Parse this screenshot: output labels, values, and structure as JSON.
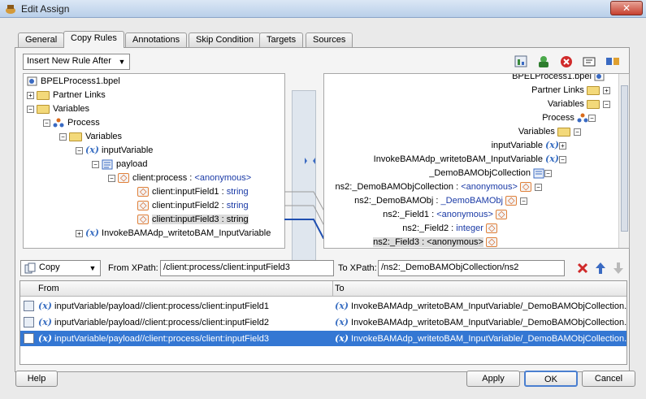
{
  "window": {
    "title": "Edit Assign",
    "close_glyph": "✕"
  },
  "tabs": [
    {
      "label": "General"
    },
    {
      "label": "Copy Rules",
      "active": true
    },
    {
      "label": "Annotations"
    },
    {
      "label": "Skip Condition"
    },
    {
      "label": "Targets"
    },
    {
      "label": "Sources"
    }
  ],
  "rule_combo": {
    "value": "Insert New Rule After"
  },
  "toolbar_icons": [
    "expression-icon",
    "add-icon",
    "delete-icon",
    "xml-literal-icon",
    "transform-icon"
  ],
  "source_tree": [
    {
      "label": "BPELProcess1.bpel"
    },
    {
      "label": "Partner Links"
    },
    {
      "label": "Variables"
    },
    {
      "label": "Process"
    },
    {
      "label": "Variables"
    },
    {
      "label": "inputVariable"
    },
    {
      "label": "payload"
    },
    {
      "label": "client:process : ",
      "type": "<anonymous>"
    },
    {
      "label": "client:inputField1 : ",
      "type": "string"
    },
    {
      "label": "client:inputField2 : ",
      "type": "string"
    },
    {
      "label": "client:inputField3 : ",
      "type": "string"
    },
    {
      "label": "InvokeBAMAdp_writetoBAM_InputVariable"
    }
  ],
  "target_tree": [
    {
      "label": "BPELProcess1.bpel"
    },
    {
      "label": "Partner Links"
    },
    {
      "label": "Variables"
    },
    {
      "label": "Process"
    },
    {
      "label": "Variables"
    },
    {
      "label": "inputVariable"
    },
    {
      "label": "InvokeBAMAdp_writetoBAM_InputVariable"
    },
    {
      "label": "_DemoBAMObjCollection"
    },
    {
      "label": "ns2:_DemoBAMObjCollection : ",
      "type": "<anonymous>"
    },
    {
      "label": "ns2:_DemoBAMObj : ",
      "type": "_DemoBAMObj"
    },
    {
      "label": "ns2:_Field1 : ",
      "type": "<anonymous>"
    },
    {
      "label": "ns2:_Field2 : ",
      "type": "integer"
    },
    {
      "label": "ns2:_Field3 : <anonymous>"
    }
  ],
  "copy_bar": {
    "operation": "Copy",
    "from_label": "From XPath:",
    "from_value": "/client:process/client:inputField3",
    "to_label": "To XPath:",
    "to_value": "/ns2:_DemoBAMObjCollection/ns2"
  },
  "rules_table": {
    "headers": {
      "from": "From",
      "to": "To"
    },
    "rows": [
      {
        "from": "inputVariable/payload//client:process/client:inputField1",
        "to": "InvokeBAMAdp_writetoBAM_InputVariable/_DemoBAMObjCollection..."
      },
      {
        "from": "inputVariable/payload//client:process/client:inputField2",
        "to": "InvokeBAMAdp_writetoBAM_InputVariable/_DemoBAMObjCollection..."
      },
      {
        "from": "inputVariable/payload//client:process/client:inputField3",
        "to": "InvokeBAMAdp_writetoBAM_InputVariable/_DemoBAMObjCollection...",
        "selected": true
      }
    ]
  },
  "buttons": {
    "help": "Help",
    "apply": "Apply",
    "ok": "OK",
    "cancel": "Cancel"
  },
  "icons": {
    "x_var": "(x)"
  },
  "colors": {
    "selection": "#3477d3",
    "type_text": "#1a3aa6",
    "link_line": "#1f4fb0"
  }
}
